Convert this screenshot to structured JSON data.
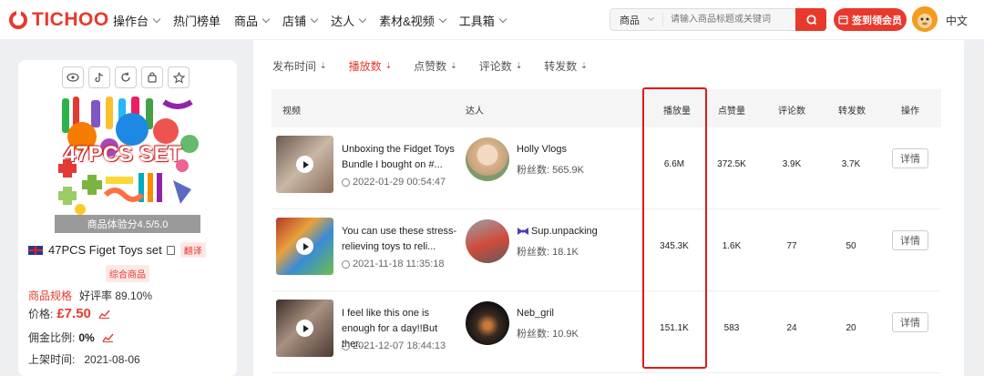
{
  "brand": {
    "name": "TICHOO",
    "accent": "#e8392c"
  },
  "nav": [
    {
      "label": "操作台",
      "dropdown": true
    },
    {
      "label": "热门榜单",
      "dropdown": false
    },
    {
      "label": "商品",
      "dropdown": true
    },
    {
      "label": "店铺",
      "dropdown": true
    },
    {
      "label": "达人",
      "dropdown": true
    },
    {
      "label": "素材&视频",
      "dropdown": true
    },
    {
      "label": "工具箱",
      "dropdown": true
    }
  ],
  "search": {
    "category": "商品",
    "placeholder": "请输入商品标题或关键词"
  },
  "member_button": "签到领会员",
  "language": "中文",
  "product": {
    "image_text": "47PCS SET",
    "score": "商品体验分4.5/5.0",
    "name": "47PCS Figet Toys set",
    "translate": "翻译",
    "tag": "综合商品",
    "spec_link": "商品规格",
    "rating": "好评率 89.10%",
    "price_label": "价格:",
    "price": "£7.50",
    "commission_label": "佣金比例:",
    "commission": "0%",
    "listed_label": "上架时间:",
    "listed": "2021-08-06"
  },
  "sort": [
    {
      "label": "发布时间",
      "active": false
    },
    {
      "label": "播放数",
      "active": true
    },
    {
      "label": "点赞数",
      "active": false
    },
    {
      "label": "评论数",
      "active": false
    },
    {
      "label": "转发数",
      "active": false
    }
  ],
  "table": {
    "headers": {
      "video": "视频",
      "creator": "达人",
      "plays": "播放量",
      "likes": "点赞量",
      "comments": "评论数",
      "shares": "转发数",
      "action": "操作"
    },
    "detail_label": "详情",
    "fans_label": "粉丝数:",
    "rows": [
      {
        "title": "Unboxing the Fidget Toys Bundle I bought on #...",
        "date": "2022-01-29 00:54:47",
        "creator": "Holly Vlogs",
        "fans": "565.9K",
        "plays": "6.6M",
        "likes": "372.5K",
        "comments": "3.9K",
        "shares": "3.7K"
      },
      {
        "title": "You can use these stress-relieving toys to reli...",
        "date": "2021-11-18 11:35:18",
        "creator": "Sup.unpacking",
        "fans": "18.1K",
        "plays": "345.3K",
        "likes": "1.6K",
        "comments": "77",
        "shares": "50"
      },
      {
        "title": "I feel like this one is enough for a day!!But ther...",
        "date": "2021-12-07 18:44:13",
        "creator": "Neb_gril",
        "fans": "10.9K",
        "plays": "151.1K",
        "likes": "583",
        "comments": "24",
        "shares": "20"
      }
    ]
  }
}
